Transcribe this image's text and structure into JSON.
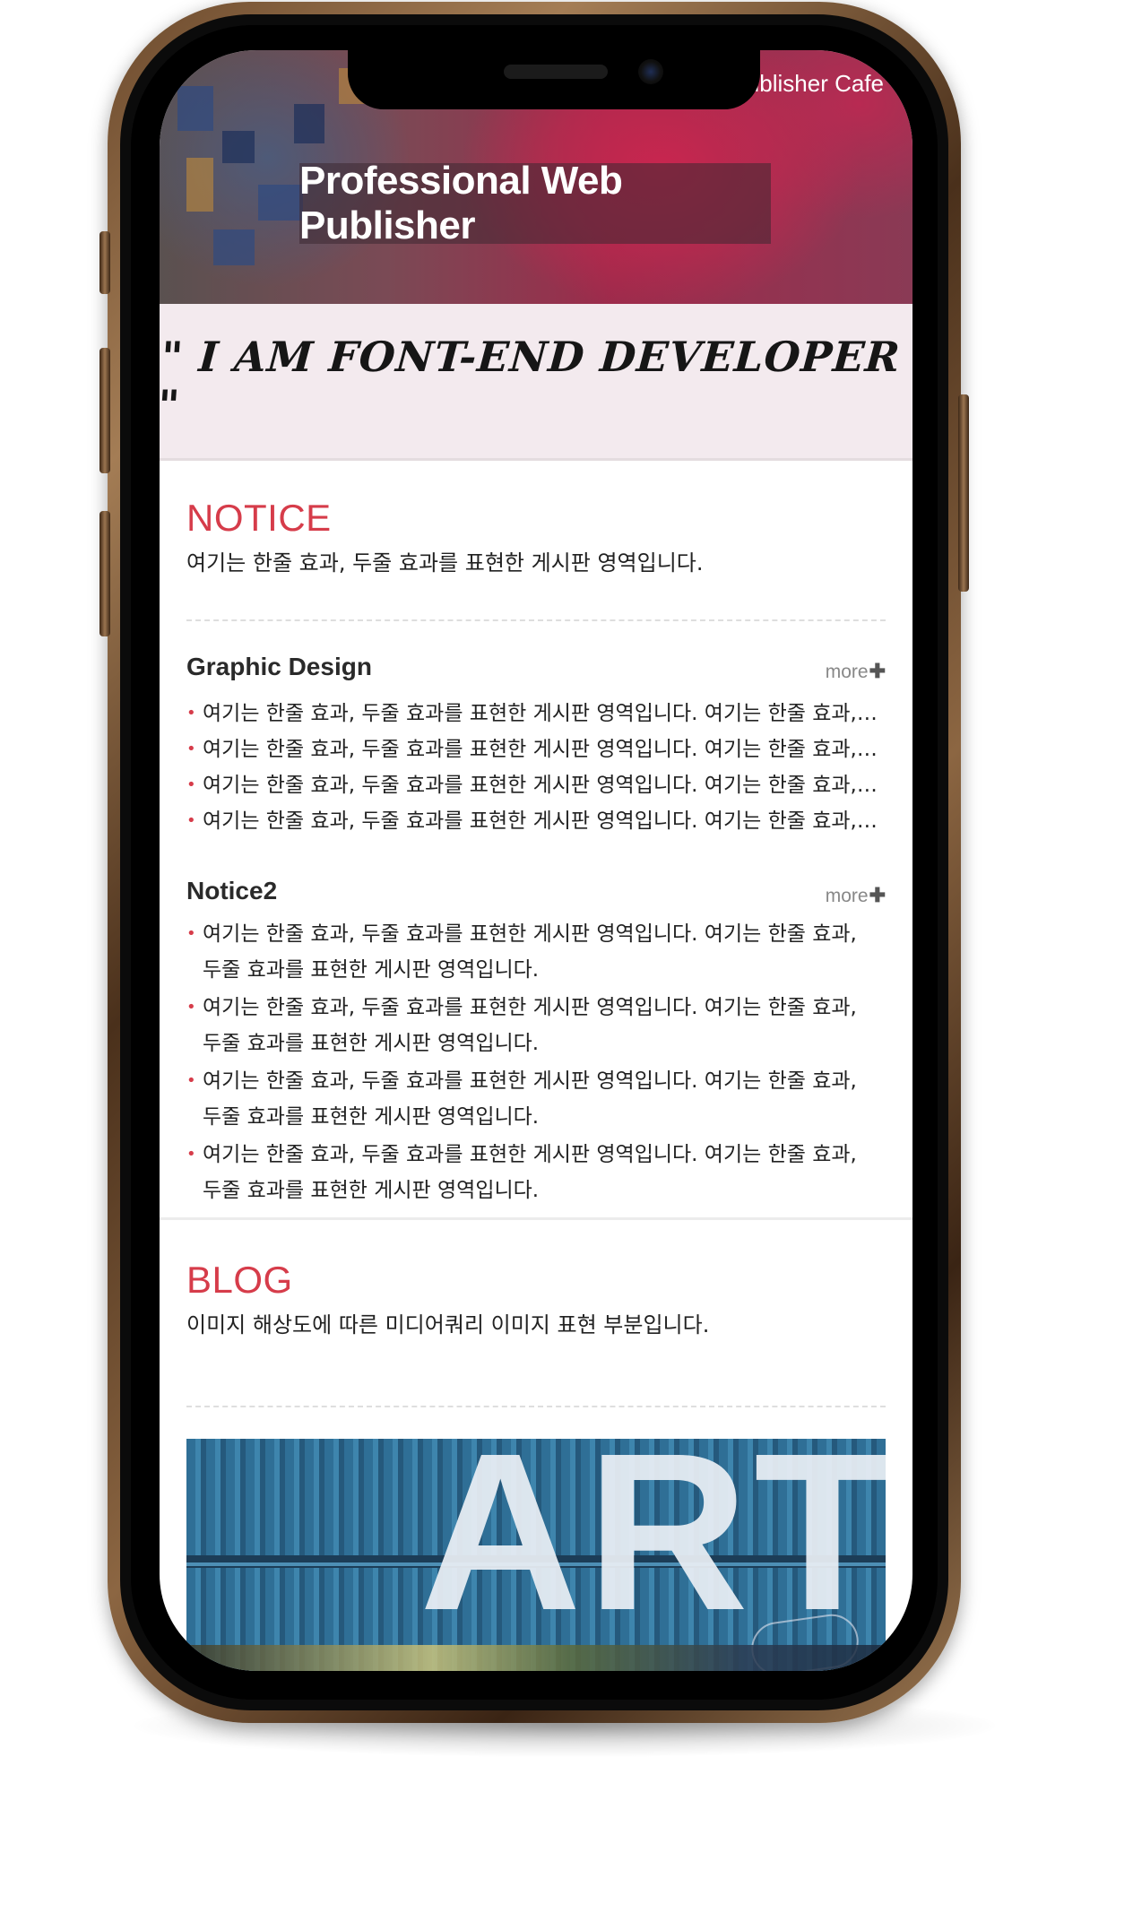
{
  "header": {
    "site_name": "ublisher Cafe",
    "hero_title": "Professional Web Publisher"
  },
  "quote": {
    "text": "\" I AM FONT-END DEVELOPER \""
  },
  "notice": {
    "title": "NOTICE",
    "description": "여기는 한줄 효과, 두줄 효과를 표현한 게시판 영역입니다.",
    "boards": [
      {
        "title": "Graphic Design",
        "more_label": "more",
        "items": [
          "여기는 한줄 효과, 두줄 효과를 표현한 게시판 영역입니다. 여기는 한줄 효과, 두줄 효과를 표현한 게시판 영역입니다.",
          "여기는 한줄 효과, 두줄 효과를 표현한 게시판 영역입니다. 여기는 한줄 효과, 두줄 효과를 표현한 게시판 영역입니다.",
          "여기는 한줄 효과, 두줄 효과를 표현한 게시판 영역입니다. 여기는 한줄 효과, 두줄 효과를 표현한 게시판 영역입니다.",
          "여기는 한줄 효과, 두줄 효과를 표현한 게시판 영역입니다. 여기는 한줄 효과, 두줄 효과를 표현한 게시판 영역입니다."
        ]
      },
      {
        "title": "Notice2",
        "more_label": "more",
        "items": [
          "여기는 한줄 효과, 두줄 효과를 표현한 게시판 영역입니다. 여기는 한줄 효과, 두줄 효과를 표현한 게시판 영역입니다.",
          "여기는 한줄 효과, 두줄 효과를 표현한 게시판 영역입니다. 여기는 한줄 효과, 두줄 효과를 표현한 게시판 영역입니다.",
          "여기는 한줄 효과, 두줄 효과를 표현한 게시판 영역입니다. 여기는 한줄 효과, 두줄 효과를 표현한 게시판 영역입니다.",
          "여기는 한줄 효과, 두줄 효과를 표현한 게시판 영역입니다. 여기는 한줄 효과, 두줄 효과를 표현한 게시판 영역입니다."
        ]
      }
    ]
  },
  "blog": {
    "title": "BLOG",
    "description": "이미지 해상도에 따른 미디어쿼리 이미지 표현 부분입니다.",
    "image_text": "ART"
  },
  "colors": {
    "accent": "#d63c4a",
    "quote_bg": "#f3eaee",
    "frame_gold": "#8c6642"
  },
  "icons": {
    "more": "plus-icon",
    "bullet": "dot-bullet-icon"
  }
}
